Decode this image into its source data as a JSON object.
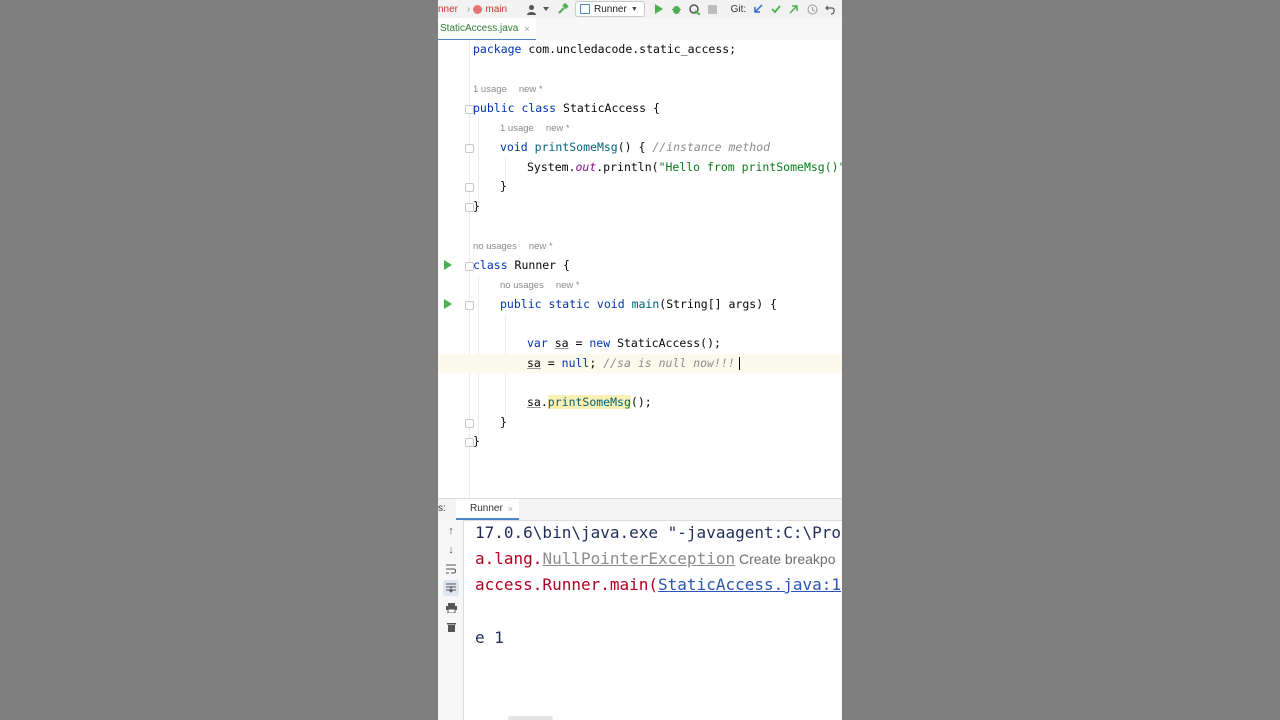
{
  "toolbar": {
    "crumb_runner": "nner",
    "crumb_main": "main",
    "run_config": "Runner",
    "git_label": "Git:"
  },
  "tab": {
    "filename": "StaticAccess.java",
    "close": "×"
  },
  "editor": {
    "line_package_kw": "package",
    "line_package_name": " com.uncledacode.static_access;",
    "hint1_usage": "1 usage",
    "hint1_new": "new *",
    "class_kw": "public class",
    "class_name": " StaticAccess {",
    "hint2_usage": "1 usage",
    "hint2_new": "new *",
    "method_kw": "void",
    "method_name": "printSomeMsg",
    "method_rest": "() { ",
    "method_comment": "//instance method",
    "println_sys": "System.",
    "println_out": "out",
    "println_call": ".println(",
    "println_str": "\"Hello from printSomeMsg()\"",
    "println_end": ");",
    "close_brace_inner": "}",
    "close_brace_class": "}",
    "hint3_usage": "no usages",
    "hint3_new": "new *",
    "runner_kw": "class",
    "runner_name": " Runner {",
    "hint4_usage": "no usages",
    "hint4_new": "new *",
    "main_kw": "public static void",
    "main_name": "main",
    "main_rest": "(String[] args) {",
    "var_kw": "var",
    "var_name": "sa",
    "var_eq": " = ",
    "new_kw": "new",
    "var_rest": " StaticAccess();",
    "null_var": "sa",
    "null_eq": " = ",
    "null_kw": "null",
    "null_semicolon": "; ",
    "null_comment": "//sa is null now!!!",
    "call_var": "sa",
    "call_dot": ".",
    "call_method": "printSomeMsg",
    "call_end": "();",
    "close_main": "}",
    "close_runner": "}"
  },
  "run_panel": {
    "tab_label": "Runner",
    "tab_close": "×",
    "header_left": "s:"
  },
  "console": {
    "line1": "17.0.6\\bin\\java.exe \"-javaagent:C:\\Pro",
    "line2_prefix": "a.lang.",
    "line2_exception": "NullPointerException",
    "line2_hint": " Create breakpo",
    "line3_prefix": "access.Runner.main(",
    "line3_link": "StaticAccess.java:1",
    "line4": "e 1"
  }
}
